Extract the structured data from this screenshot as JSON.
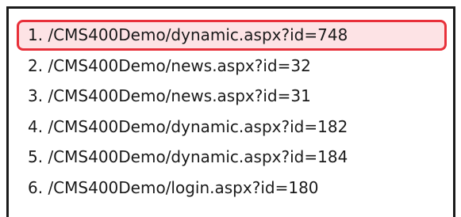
{
  "url_list": {
    "items": [
      {
        "label": "1. /CMS400Demo/dynamic.aspx?id=748",
        "selected": true
      },
      {
        "label": "2. /CMS400Demo/news.aspx?id=32",
        "selected": false
      },
      {
        "label": "3. /CMS400Demo/news.aspx?id=31",
        "selected": false
      },
      {
        "label": "4. /CMS400Demo/dynamic.aspx?id=182",
        "selected": false
      },
      {
        "label": "5. /CMS400Demo/dynamic.aspx?id=184",
        "selected": false
      },
      {
        "label": "6. /CMS400Demo/login.aspx?id=180",
        "selected": false
      }
    ],
    "highlight_color": "#e8303a",
    "highlight_fill": "#fde3e5"
  }
}
